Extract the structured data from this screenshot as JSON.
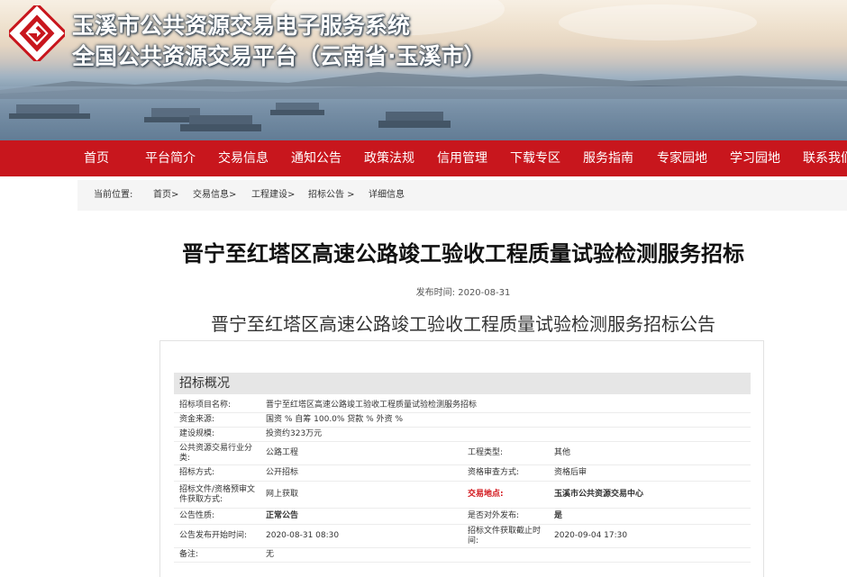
{
  "header": {
    "title_line1": "玉溪市公共资源交易电子服务系统",
    "title_line2": "全国公共资源交易平台（云南省·玉溪市）",
    "logo_icon": "logo-icon",
    "brand_color": "#c8161d"
  },
  "nav": {
    "items": [
      "首页",
      "平台简介",
      "交易信息",
      "通知公告",
      "政策法规",
      "信用管理",
      "下载专区",
      "服务指南",
      "专家园地",
      "学习园地",
      "联系我们"
    ]
  },
  "breadcrumb": {
    "prefix": "当前位置:",
    "items": [
      "首页>",
      "交易信息>",
      "工程建设>",
      "招标公告 >",
      "详细信息"
    ]
  },
  "article": {
    "headline": "晋宁至红塔区高速公路竣工验收工程质量试验检测服务招标",
    "pub_date_label": "发布时间:",
    "pub_date": "2020-08-31",
    "subtitle": "晋宁至红塔区高速公路竣工验收工程质量试验检测服务招标公告"
  },
  "overview": {
    "heading": "招标概况",
    "rows": [
      {
        "l1": "招标项目名称:",
        "v1": "晋宁至红塔区高速公路竣工验收工程质量试验检测服务招标",
        "l2": "",
        "v2": ""
      },
      {
        "l1": "资金来源:",
        "v1": "国资 % 自筹 100.0% 贷款 % 外资 %",
        "l2": "",
        "v2": ""
      },
      {
        "l1": "建设规模:",
        "v1": "投资约323万元",
        "l2": "",
        "v2": ""
      },
      {
        "l1": "公共资源交易行业分类:",
        "v1": "公路工程",
        "l2": "工程类型:",
        "v2": "其他"
      },
      {
        "l1": "招标方式:",
        "v1": "公开招标",
        "l2": "资格审查方式:",
        "v2": "资格后审"
      },
      {
        "l1": "招标文件/资格预审文件获取方式:",
        "v1": "网上获取",
        "l2": "交易地点:",
        "v2": "玉溪市公共资源交易中心"
      },
      {
        "l1": "公告性质:",
        "v1": "正常公告",
        "l2": "是否对外发布:",
        "v2": "是"
      },
      {
        "l1": "公告发布开始时间:",
        "v1": "2020-08-31 08:30",
        "l2": "招标文件获取截止时间:",
        "v2": "2020-09-04 17:30"
      },
      {
        "l1": "备注:",
        "v1": "无",
        "l2": "",
        "v2": ""
      }
    ]
  }
}
